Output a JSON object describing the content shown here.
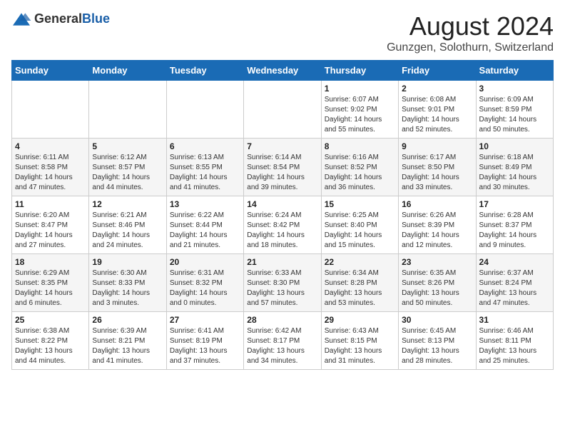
{
  "header": {
    "logo_general": "General",
    "logo_blue": "Blue",
    "month_title": "August 2024",
    "location": "Gunzgen, Solothurn, Switzerland"
  },
  "days_of_week": [
    "Sunday",
    "Monday",
    "Tuesday",
    "Wednesday",
    "Thursday",
    "Friday",
    "Saturday"
  ],
  "weeks": [
    [
      {
        "day": "",
        "sunrise": "",
        "sunset": "",
        "daylight": ""
      },
      {
        "day": "",
        "sunrise": "",
        "sunset": "",
        "daylight": ""
      },
      {
        "day": "",
        "sunrise": "",
        "sunset": "",
        "daylight": ""
      },
      {
        "day": "",
        "sunrise": "",
        "sunset": "",
        "daylight": ""
      },
      {
        "day": "1",
        "sunrise": "6:07 AM",
        "sunset": "9:02 PM",
        "daylight": "14 hours and 55 minutes."
      },
      {
        "day": "2",
        "sunrise": "6:08 AM",
        "sunset": "9:01 PM",
        "daylight": "14 hours and 52 minutes."
      },
      {
        "day": "3",
        "sunrise": "6:09 AM",
        "sunset": "8:59 PM",
        "daylight": "14 hours and 50 minutes."
      }
    ],
    [
      {
        "day": "4",
        "sunrise": "6:11 AM",
        "sunset": "8:58 PM",
        "daylight": "14 hours and 47 minutes."
      },
      {
        "day": "5",
        "sunrise": "6:12 AM",
        "sunset": "8:57 PM",
        "daylight": "14 hours and 44 minutes."
      },
      {
        "day": "6",
        "sunrise": "6:13 AM",
        "sunset": "8:55 PM",
        "daylight": "14 hours and 41 minutes."
      },
      {
        "day": "7",
        "sunrise": "6:14 AM",
        "sunset": "8:54 PM",
        "daylight": "14 hours and 39 minutes."
      },
      {
        "day": "8",
        "sunrise": "6:16 AM",
        "sunset": "8:52 PM",
        "daylight": "14 hours and 36 minutes."
      },
      {
        "day": "9",
        "sunrise": "6:17 AM",
        "sunset": "8:50 PM",
        "daylight": "14 hours and 33 minutes."
      },
      {
        "day": "10",
        "sunrise": "6:18 AM",
        "sunset": "8:49 PM",
        "daylight": "14 hours and 30 minutes."
      }
    ],
    [
      {
        "day": "11",
        "sunrise": "6:20 AM",
        "sunset": "8:47 PM",
        "daylight": "14 hours and 27 minutes."
      },
      {
        "day": "12",
        "sunrise": "6:21 AM",
        "sunset": "8:46 PM",
        "daylight": "14 hours and 24 minutes."
      },
      {
        "day": "13",
        "sunrise": "6:22 AM",
        "sunset": "8:44 PM",
        "daylight": "14 hours and 21 minutes."
      },
      {
        "day": "14",
        "sunrise": "6:24 AM",
        "sunset": "8:42 PM",
        "daylight": "14 hours and 18 minutes."
      },
      {
        "day": "15",
        "sunrise": "6:25 AM",
        "sunset": "8:40 PM",
        "daylight": "14 hours and 15 minutes."
      },
      {
        "day": "16",
        "sunrise": "6:26 AM",
        "sunset": "8:39 PM",
        "daylight": "14 hours and 12 minutes."
      },
      {
        "day": "17",
        "sunrise": "6:28 AM",
        "sunset": "8:37 PM",
        "daylight": "14 hours and 9 minutes."
      }
    ],
    [
      {
        "day": "18",
        "sunrise": "6:29 AM",
        "sunset": "8:35 PM",
        "daylight": "14 hours and 6 minutes."
      },
      {
        "day": "19",
        "sunrise": "6:30 AM",
        "sunset": "8:33 PM",
        "daylight": "14 hours and 3 minutes."
      },
      {
        "day": "20",
        "sunrise": "6:31 AM",
        "sunset": "8:32 PM",
        "daylight": "14 hours and 0 minutes."
      },
      {
        "day": "21",
        "sunrise": "6:33 AM",
        "sunset": "8:30 PM",
        "daylight": "13 hours and 57 minutes."
      },
      {
        "day": "22",
        "sunrise": "6:34 AM",
        "sunset": "8:28 PM",
        "daylight": "13 hours and 53 minutes."
      },
      {
        "day": "23",
        "sunrise": "6:35 AM",
        "sunset": "8:26 PM",
        "daylight": "13 hours and 50 minutes."
      },
      {
        "day": "24",
        "sunrise": "6:37 AM",
        "sunset": "8:24 PM",
        "daylight": "13 hours and 47 minutes."
      }
    ],
    [
      {
        "day": "25",
        "sunrise": "6:38 AM",
        "sunset": "8:22 PM",
        "daylight": "13 hours and 44 minutes."
      },
      {
        "day": "26",
        "sunrise": "6:39 AM",
        "sunset": "8:21 PM",
        "daylight": "13 hours and 41 minutes."
      },
      {
        "day": "27",
        "sunrise": "6:41 AM",
        "sunset": "8:19 PM",
        "daylight": "13 hours and 37 minutes."
      },
      {
        "day": "28",
        "sunrise": "6:42 AM",
        "sunset": "8:17 PM",
        "daylight": "13 hours and 34 minutes."
      },
      {
        "day": "29",
        "sunrise": "6:43 AM",
        "sunset": "8:15 PM",
        "daylight": "13 hours and 31 minutes."
      },
      {
        "day": "30",
        "sunrise": "6:45 AM",
        "sunset": "8:13 PM",
        "daylight": "13 hours and 28 minutes."
      },
      {
        "day": "31",
        "sunrise": "6:46 AM",
        "sunset": "8:11 PM",
        "daylight": "13 hours and 25 minutes."
      }
    ]
  ],
  "labels": {
    "sunrise_prefix": "Sunrise: ",
    "sunset_prefix": "Sunset: ",
    "daylight_prefix": "Daylight: "
  }
}
